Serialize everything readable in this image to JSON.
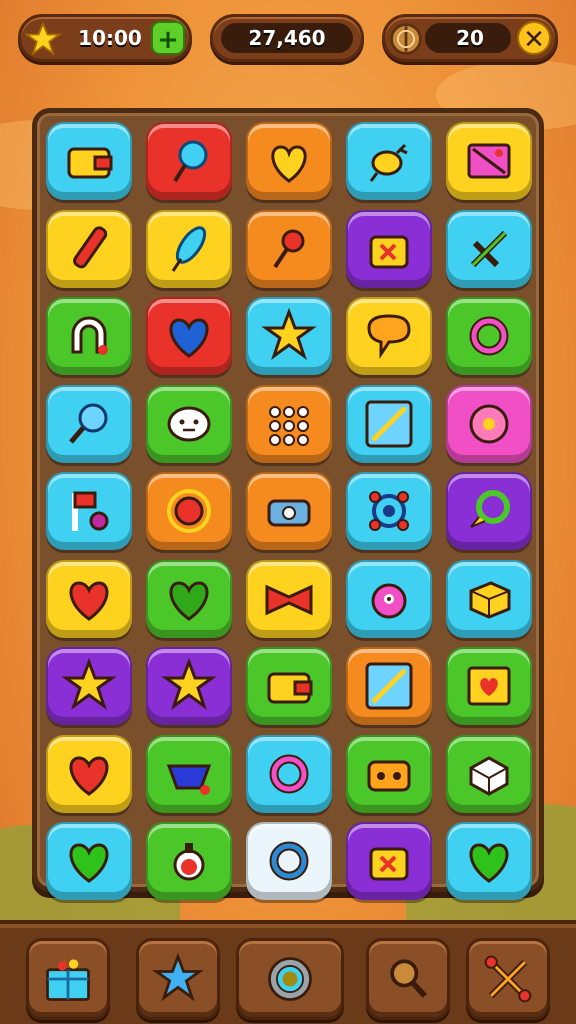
{
  "hud": {
    "time_label": "10:00",
    "score_label": "27,460",
    "coins_label": "20"
  },
  "colors": {
    "blue": "#3fd0f2",
    "red": "#e8322a",
    "orange": "#f58a1f",
    "yellow": "#ffd21f",
    "purple": "#8a2fd6",
    "green": "#4cc72a",
    "pink": "#f04fc6",
    "white": "#eaf6fb"
  },
  "board": {
    "rows": [
      [
        {
          "color": "blue",
          "icon": "wallet-icon"
        },
        {
          "color": "red",
          "icon": "cotton-candy-icon"
        },
        {
          "color": "orange",
          "icon": "heart-outline-icon"
        },
        {
          "color": "blue",
          "icon": "bug-icon"
        },
        {
          "color": "yellow",
          "icon": "envelope-icon"
        }
      ],
      [
        {
          "color": "yellow",
          "icon": "pencil-icon"
        },
        {
          "color": "yellow",
          "icon": "feather-icon"
        },
        {
          "color": "orange",
          "icon": "pin-icon"
        },
        {
          "color": "purple",
          "icon": "bag-icon"
        },
        {
          "color": "blue",
          "icon": "swords-icon"
        }
      ],
      [
        {
          "color": "green",
          "icon": "magnet-icon"
        },
        {
          "color": "red",
          "icon": "heart-icon"
        },
        {
          "color": "blue",
          "icon": "star-icon"
        },
        {
          "color": "yellow",
          "icon": "speech-bubble-icon"
        },
        {
          "color": "green",
          "icon": "ring-icon"
        }
      ],
      [
        {
          "color": "blue",
          "icon": "magnifier-icon"
        },
        {
          "color": "green",
          "icon": "face-icon"
        },
        {
          "color": "orange",
          "icon": "dots-icon"
        },
        {
          "color": "blue",
          "icon": "pen-icon"
        },
        {
          "color": "pink",
          "icon": "flower-icon"
        }
      ],
      [
        {
          "color": "blue",
          "icon": "flag-icon"
        },
        {
          "color": "orange",
          "icon": "apple-ring-icon"
        },
        {
          "color": "orange",
          "icon": "camera-icon"
        },
        {
          "color": "blue",
          "icon": "gear-icon"
        },
        {
          "color": "purple",
          "icon": "chat-ring-icon"
        }
      ],
      [
        {
          "color": "yellow",
          "icon": "heart-icon"
        },
        {
          "color": "green",
          "icon": "heart-icon"
        },
        {
          "color": "yellow",
          "icon": "bow-icon"
        },
        {
          "color": "blue",
          "icon": "monster-icon"
        },
        {
          "color": "blue",
          "icon": "cube-icon"
        }
      ],
      [
        {
          "color": "purple",
          "icon": "star-icon"
        },
        {
          "color": "purple",
          "icon": "star-icon"
        },
        {
          "color": "green",
          "icon": "wallet-icon"
        },
        {
          "color": "orange",
          "icon": "pen-icon"
        },
        {
          "color": "green",
          "icon": "heart-card-icon"
        }
      ],
      [
        {
          "color": "yellow",
          "icon": "heart-icon"
        },
        {
          "color": "green",
          "icon": "bowl-icon"
        },
        {
          "color": "blue",
          "icon": "ring-icon"
        },
        {
          "color": "green",
          "icon": "radio-icon"
        },
        {
          "color": "green",
          "icon": "box-icon"
        }
      ],
      [
        {
          "color": "blue",
          "icon": "heart-icon"
        },
        {
          "color": "green",
          "icon": "potion-icon"
        },
        {
          "color": "white",
          "icon": "ring-icon"
        },
        {
          "color": "purple",
          "icon": "bag-icon"
        },
        {
          "color": "blue",
          "icon": "heart-icon"
        }
      ]
    ]
  },
  "bottom_buttons": [
    {
      "name": "gift-box-button",
      "icon": "gift-box-icon"
    },
    {
      "name": "star-button",
      "icon": "star-icon"
    },
    {
      "name": "settings-button",
      "icon": "gear-icon"
    },
    {
      "name": "search-button",
      "icon": "magnifier-icon"
    },
    {
      "name": "tools-button",
      "icon": "crossed-tools-icon"
    }
  ]
}
